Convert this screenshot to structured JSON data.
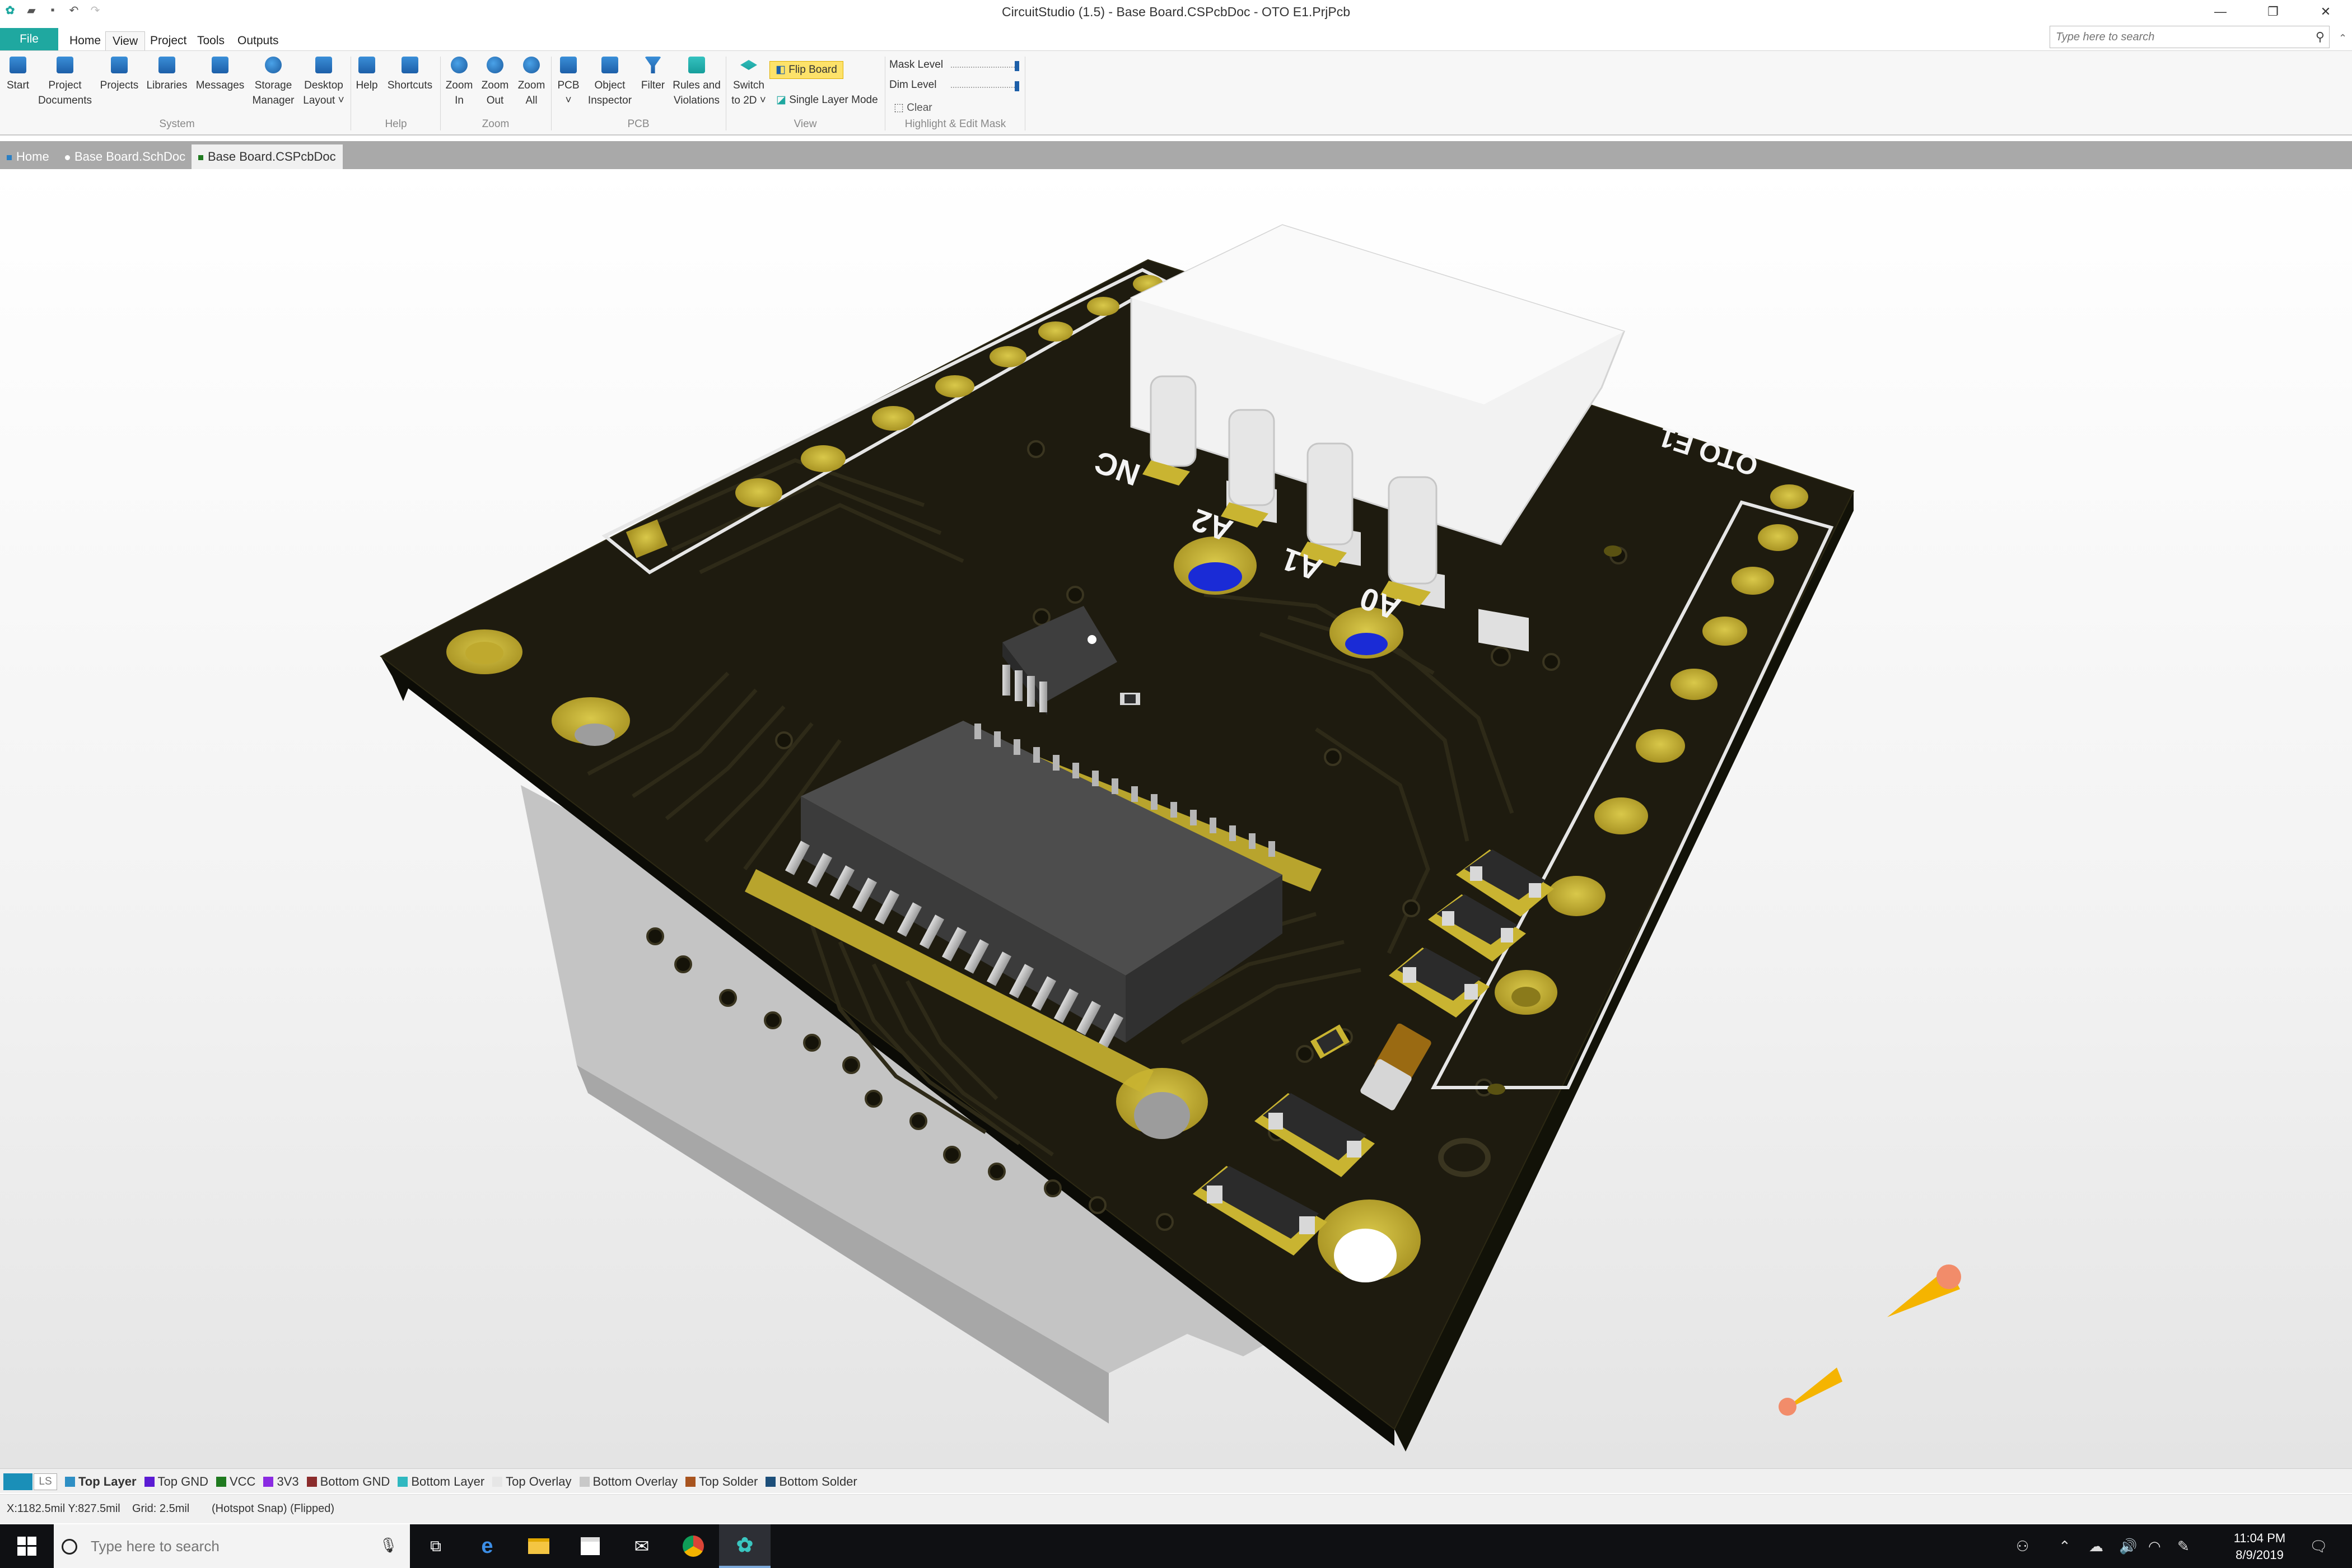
{
  "window": {
    "title": "CircuitStudio (1.5) - Base Board.CSPcbDoc - OTO E1.PrjPcb",
    "controls": [
      "minimize-icon",
      "restore-icon",
      "close-icon"
    ]
  },
  "ribbon_tabs": [
    "File",
    "Home",
    "View",
    "Project",
    "Tools",
    "Outputs"
  ],
  "search": {
    "placeholder": "Type here to search"
  },
  "ribbon": {
    "groups": {
      "system": "System",
      "help": "Help",
      "zoom": "Zoom",
      "pcb": "PCB",
      "view": "View",
      "mask": "Highlight & Edit Mask"
    },
    "buttons": {
      "start": [
        "Start"
      ],
      "project_documents": [
        "Project",
        "Documents"
      ],
      "projects": [
        "Projects"
      ],
      "libraries": [
        "Libraries"
      ],
      "messages": [
        "Messages"
      ],
      "storage_manager": [
        "Storage",
        "Manager"
      ],
      "desktop_layout": [
        "Desktop",
        "Layout ˅"
      ],
      "help": [
        "Help"
      ],
      "shortcuts": [
        "Shortcuts"
      ],
      "zoom_in": [
        "Zoom",
        "In"
      ],
      "zoom_out": [
        "Zoom",
        "Out"
      ],
      "zoom_all": [
        "Zoom",
        "All"
      ],
      "pcb": [
        "PCB",
        "˅"
      ],
      "object_inspector": [
        "Object",
        "Inspector"
      ],
      "filter": [
        "Filter"
      ],
      "rules_violations": [
        "Rules and",
        "Violations"
      ],
      "switch_2d": [
        "Switch",
        "to 2D ˅"
      ]
    },
    "flip_board": "Flip Board",
    "single_layer_mode": "Single Layer Mode",
    "mask_level": "Mask Level",
    "dim_level": "Dim Level",
    "clear": "Clear"
  },
  "doc_tabs": [
    {
      "label": "Home",
      "active": false
    },
    {
      "label": "Base Board.SchDoc",
      "active": false
    },
    {
      "label": "Base Board.CSPcbDoc",
      "active": true
    }
  ],
  "board": {
    "silkscreen": {
      "nc": "NC",
      "a2": "A2",
      "a1": "A1",
      "a0": "A0",
      "name": "OTO E1"
    },
    "colors": {
      "soldermask": "#1e1b0f",
      "pad_gold": "#c9b431",
      "via_blue": "#1a2bd6",
      "ic_body": "#4a4a4a",
      "connector": "#f2f2f2"
    }
  },
  "layers": {
    "ls": "LS",
    "tabs": [
      {
        "label": "Top Layer",
        "color": "#2e8fc4",
        "active": true
      },
      {
        "label": "Top GND",
        "color": "#5b1bd3"
      },
      {
        "label": "VCC",
        "color": "#1f7a1f"
      },
      {
        "label": "3V3",
        "color": "#8a2be2"
      },
      {
        "label": "Bottom GND",
        "color": "#8b2c2c"
      },
      {
        "label": "Bottom Layer",
        "color": "#30b8c0"
      },
      {
        "label": "Top Overlay",
        "color": "#e6e6e6"
      },
      {
        "label": "Bottom Overlay",
        "color": "#c8c8c8"
      },
      {
        "label": "Top Solder",
        "color": "#a8541f"
      },
      {
        "label": "Bottom Solder",
        "color": "#1d4f7a"
      }
    ]
  },
  "status": {
    "coords": "X:1182.5mil Y:827.5mil",
    "grid": "Grid: 2.5mil",
    "snap": "(Hotspot Snap) (Flipped)"
  },
  "taskbar": {
    "search_placeholder": "Type here to search",
    "time": "11:04 PM",
    "date": "8/9/2019"
  }
}
